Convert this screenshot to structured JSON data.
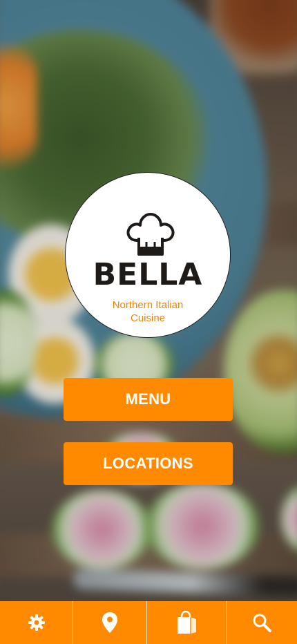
{
  "brand": {
    "name": "BELLA",
    "tagline_line1": "Northern Italian",
    "tagline_line2": "Cuisine",
    "logo_icon": "chef-hat-icon"
  },
  "buttons": {
    "menu_label": "MENU",
    "locations_label": "LOCATIONS"
  },
  "tabbar": {
    "items": [
      {
        "icon": "gear-icon"
      },
      {
        "icon": "map-pin-icon"
      },
      {
        "icon": "shopping-bag-icon"
      },
      {
        "icon": "search-icon"
      }
    ]
  },
  "colors": {
    "accent": "#ff8a00",
    "tagline": "#e8850a",
    "logo_text": "#1e1a18",
    "logo_bg": "#ffffff"
  }
}
